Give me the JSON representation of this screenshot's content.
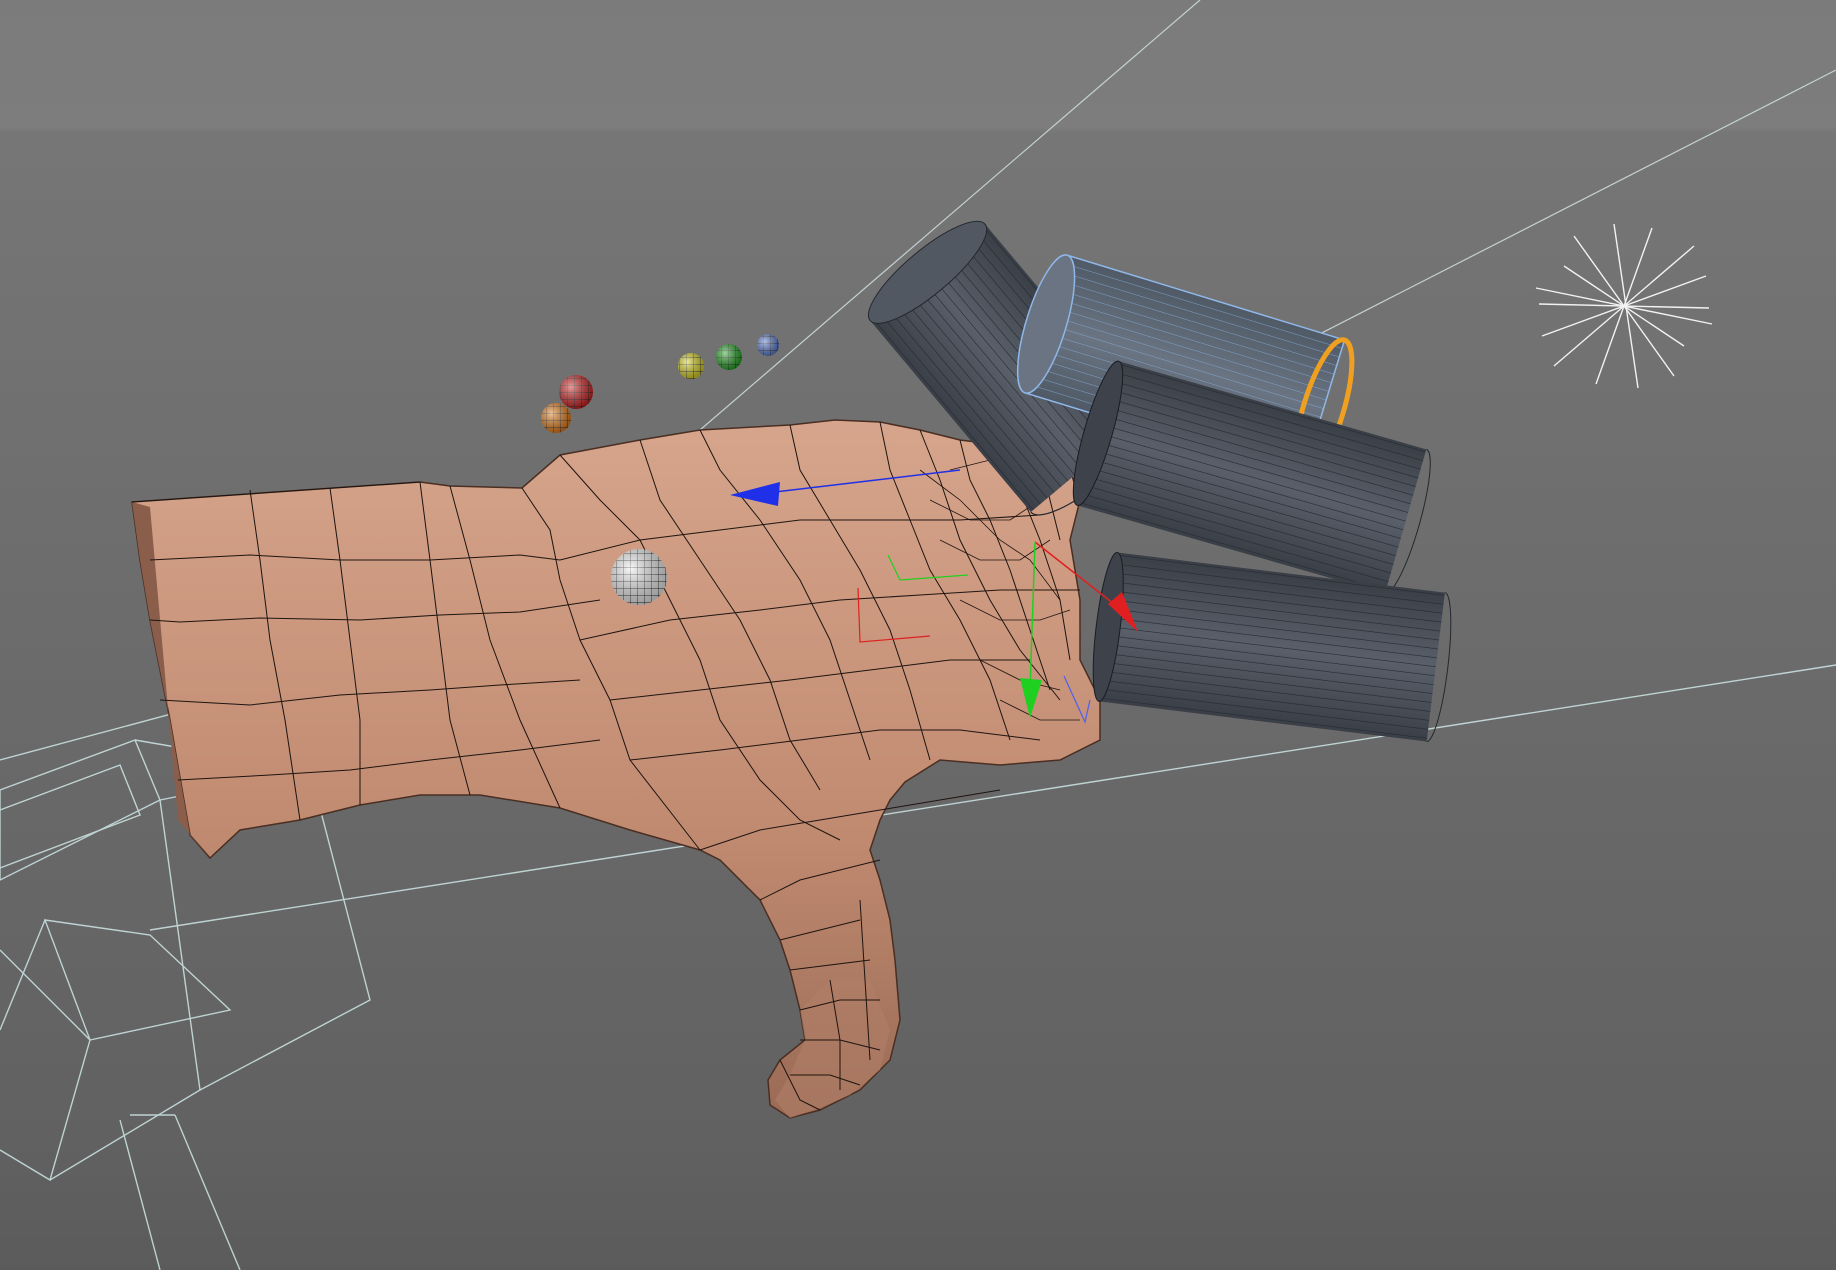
{
  "viewport": {
    "name": "3D viewport",
    "background_top": "#7d7d7d",
    "background_bottom": "#5f5f5f"
  },
  "colors": {
    "skin": "#c49179",
    "skin_shadow": "#8a5e4a",
    "wire": "#1e1410",
    "cylinder": "#4a4f58",
    "cylinder_selected": "#5e6774",
    "selection_outline": "#8fb7e8",
    "axis_x": "#e02020",
    "axis_y": "#20d020",
    "axis_z": "#2030e8",
    "camera_wire": "#cfe6e6",
    "pivot_ring": "#f0a020"
  },
  "objects": {
    "hand_mesh": "hand",
    "cylinders": [
      "finger-cylinder-1",
      "finger-cylinder-2",
      "finger-cylinder-3",
      "finger-cylinder-4"
    ],
    "selected_cylinder": "finger-cylinder-2",
    "sphere_controls": [
      {
        "name": "red-sphere",
        "color": "#cc2020"
      },
      {
        "name": "orange-sphere",
        "color": "#e07a18"
      },
      {
        "name": "yellow-sphere",
        "color": "#d8d020"
      },
      {
        "name": "green-sphere",
        "color": "#22a022"
      },
      {
        "name": "blue-sphere",
        "color": "#5a7acc"
      },
      {
        "name": "white-sphere",
        "color": "#f0f0f0"
      }
    ],
    "light": "omni-light",
    "camera": "camera"
  }
}
